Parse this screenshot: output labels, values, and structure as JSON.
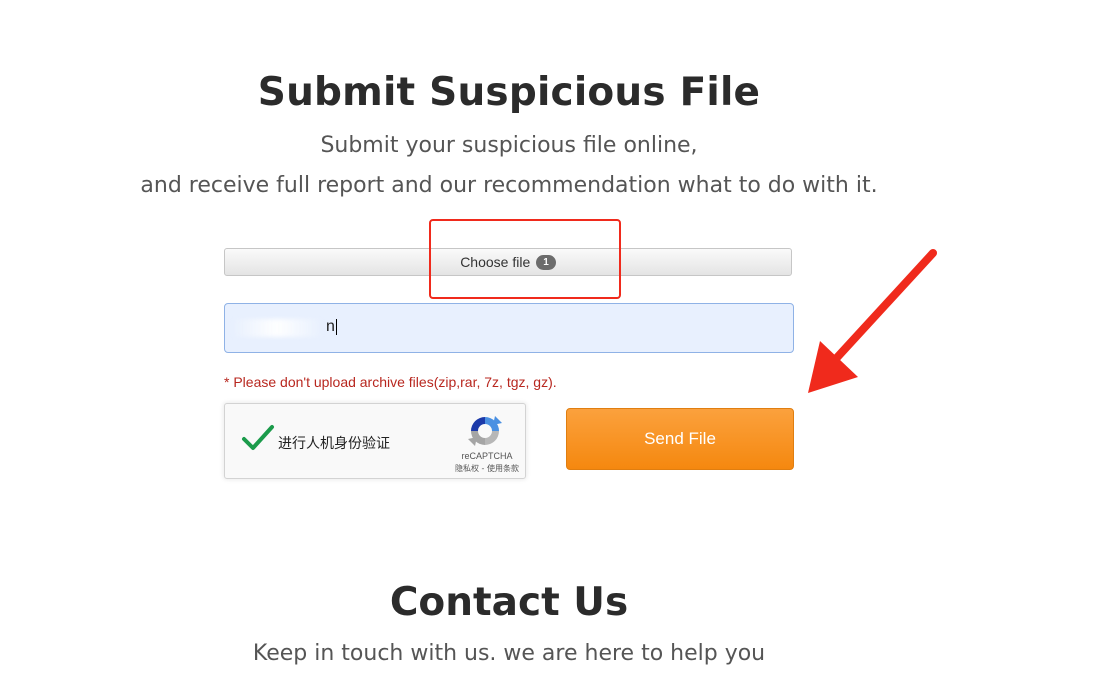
{
  "submit": {
    "title": "Submit Suspicious File",
    "subtitle_line1": "Submit your suspicious file online,",
    "subtitle_line2": "and receive full report and our recommendation what to do with it.",
    "file_button_label": "Choose file",
    "file_count": "1",
    "input_value": "n",
    "warning": "* Please don't upload archive files(zip,rar, 7z, tgz, gz).",
    "send_button_label": "Send File"
  },
  "captcha": {
    "label": "进行人机身份验证",
    "brand": "reCAPTCHA",
    "terms": "隐私权 - 使用条款",
    "checked": true,
    "check_color": "#1b9b4b"
  },
  "contact": {
    "title": "Contact Us",
    "subtitle": "Keep in touch with us. we are here to help you"
  },
  "icons": {
    "check": "checkmark-icon",
    "recaptcha": "recaptcha-logo-icon",
    "annotation_arrow": "red-arrow-icon"
  },
  "colors": {
    "accent_orange": "#f5880f",
    "annotation_red": "#f02a1c",
    "warning_red": "#b8271f",
    "input_bg": "#e8f0fe"
  }
}
